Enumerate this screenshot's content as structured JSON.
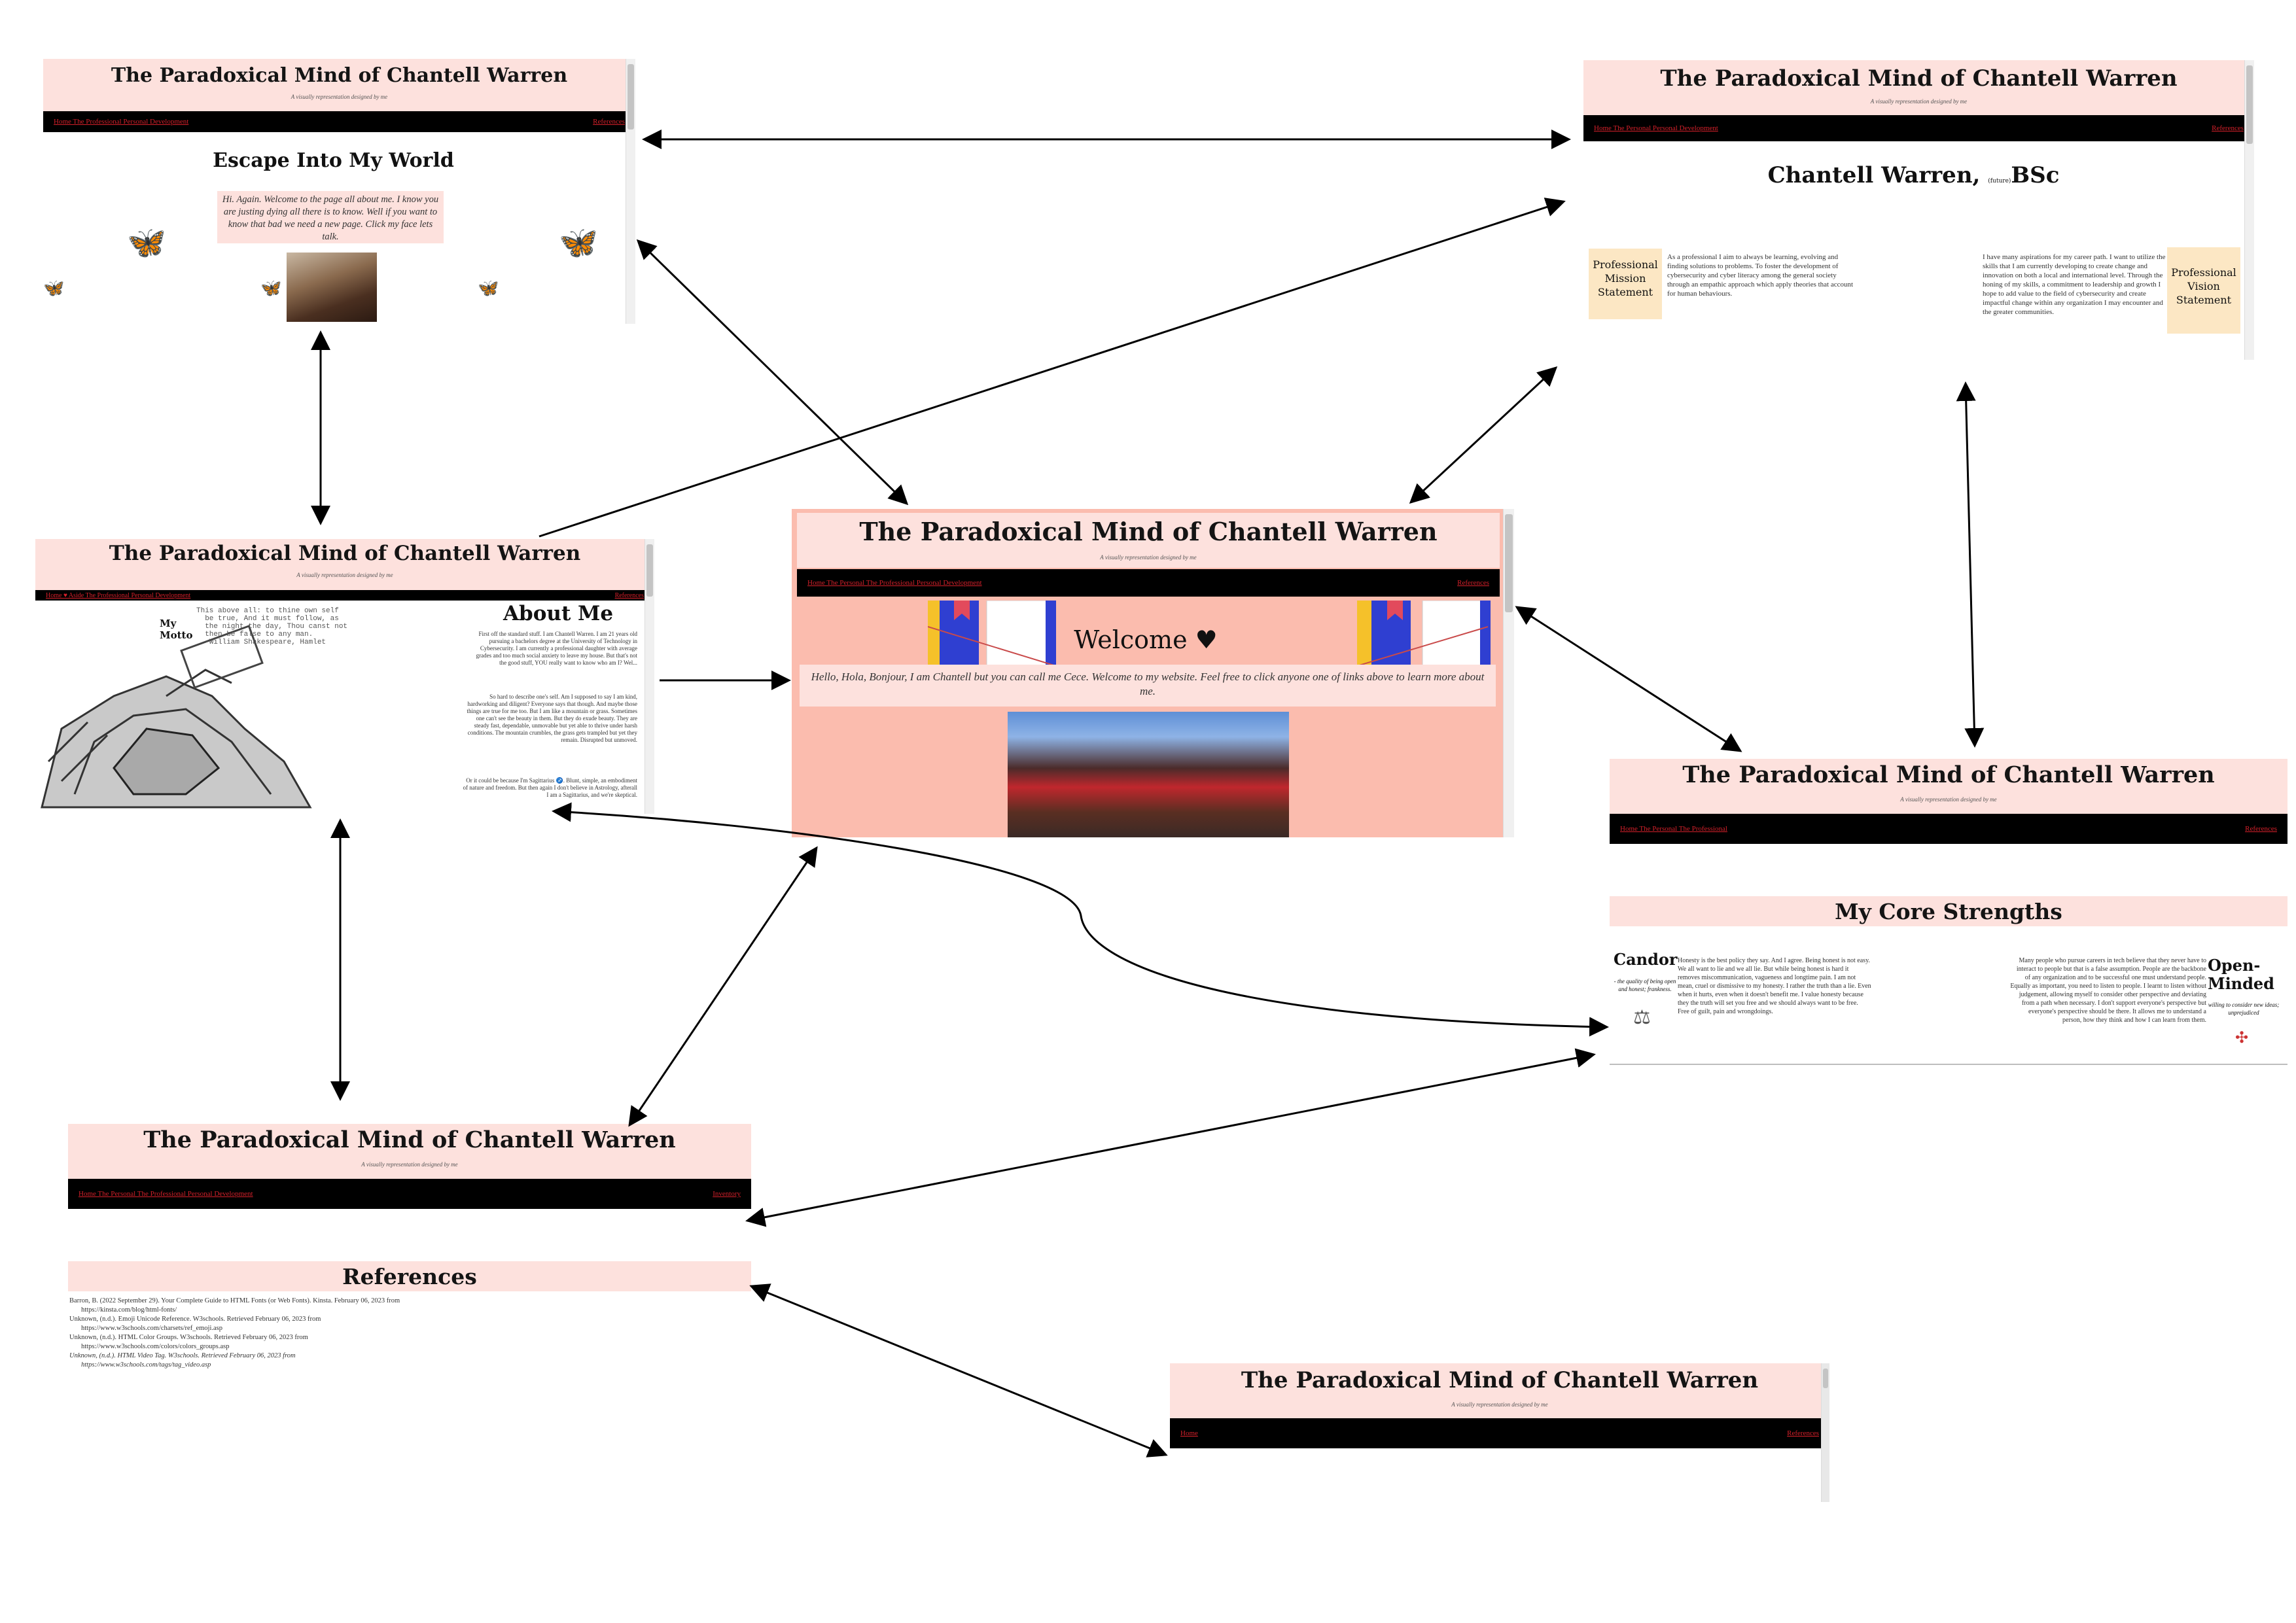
{
  "site": {
    "title": "The Paradoxical Mind of Chantell Warren",
    "subtitle": "A visually representation designed by me"
  },
  "pages": {
    "personal": {
      "nav_left": "Home The Professional Personal Development",
      "nav_right": "References",
      "heading": "Escape Into My World",
      "intro": "Hi. Again. Welcome to the page all about me. I know you are justing dying all there is to know. Well if you want to know that bad we need a new page. Click my face lets talk."
    },
    "professional": {
      "nav_left": "Home The Personal Personal Development",
      "nav_right": "References",
      "heading_name": "Chantell Warren,",
      "heading_small": "(future)",
      "heading_degree": "BSc",
      "mission_label": "Professional Mission Statement",
      "mission_text": "As a professional I aim to always be learning, evolving and finding solutions to problems. To foster the development of cybersecurity and cyber literacy among the general society through an empathic approach which apply theories that account for human behaviours.",
      "vision_label": "Professional Vision Statement",
      "vision_text": "I have many aspirations for my career path. I want to utilize the skills that I am currently developing to create change and innovation on both a local and international level. Through the honing of my skills, a commitment to leadership and growth I hope to add value to the field of cybersecurity and create impactful change within any organization I may encounter and the greater communities."
    },
    "about": {
      "nav_left": "Home ♥ Aside The Professional Personal Development",
      "nav_right": "References",
      "motto_label": "My Motto",
      "motto_text": "This above all: to thine own self\n  be true, And it must follow, as\n  the night the day, Thou canst not\n  then be false to any man.\n  -William Shakespeare, Hamlet",
      "heading": "About Me",
      "para1": "First off the standard stuff. I am Chantell Warren. I am 21 years old pursuing a bachelors degree at the University of Technology in Cybersecurity. I am currently a professional daughter with average grades and too much social anxiety to leave my house. But that's not the good stuff, YOU really want to know who am I? Wel...",
      "para2": "So hard to describe one's self. Am I supposed to say I am kind, hardworking and diligent? Everyone says that though. And maybe those things are true for me too. But I am like a mountain or grass. Sometimes one can't see the beauty in them. But they do exude beauty. They are steady fast, dependable, unmovable but yet able to thrive under harsh conditions. The mountain crumbles, the grass gets trampled but yet they remain. Disrupted but unmoved.",
      "para3": "Or it could be because I'm Sagittarius ♐. Blunt, simple, an embodiment of nature and freedom. But then again I don't believe in Astrology, afterall I am a Sagittarius, and we're skeptical."
    },
    "home": {
      "nav_left": "Home The Personal The Professional Personal Development",
      "nav_right": "References",
      "welcome": "Welcome ♥",
      "greeting": "Hello, Hola, Bonjour, I am Chantell but you can call me Cece. Welcome to my website. Feel free to click anyone one of links above to learn more about me."
    },
    "strengths": {
      "nav_left": "Home The Personal The Professional",
      "nav_right": "References",
      "heading": "My Core Strengths",
      "candor_title": "Candor",
      "candor_def": "- the quality of being open and honest; frankness.",
      "candor_text": "Honesty is the best policy they say. And I agree. Being honest is not easy. We all want to lie and we all lie. But while being honest is hard it removes miscommunication, vagueness and longtime pain. I am not mean, cruel or dismissive to my honesty. I rather the truth than a lie. Even when it hurts, even when it doesn't benefit me. I value honesty because they the truth will set you free and we should always want to be free. Free of guilt, pain and wrongdoings.",
      "open_title": "Open-Minded",
      "open_def": "willing to consider new ideas; unprejudiced",
      "open_text": "Many people who pursue careers in tech believe that they never have to interact to people but that is a false assumption. People are the backbone of any organization and to be successful one must understand people. Equally as important, you need to listen to people. I learnt to listen without judgement, allowing myself to consider other perspective and deviating from a path when necessary. I don't support everyone's perspective but everyone's perspective should be there. It allows me to understand a person, how they think and how I can learn from them."
    },
    "development": {
      "nav_left": "Home The Personal The Professional Personal Development",
      "nav_right": "Inventory"
    },
    "references": {
      "heading": "References",
      "items": [
        "Barron, B. (2022 September 29). Your Complete Guide to HTML Fonts (or Web Fonts). Kinsta. February 06, 2023 from",
        "    https://kinsta.com/blog/html-fonts/",
        "Unknown, (n.d.). Emoji Unicode Reference. W3schools. Retrieved February 06, 2023 from",
        "    https://www.w3schools.com/charsets/ref_emoji.asp",
        "Unknown, (n.d.). HTML Color Groups. W3schools. Retrieved February 06, 2023 from",
        "    https://www.w3schools.com/colors/colors_groups.asp",
        "Unknown, (n.d.). HTML Video Tag. W3schools. Retrieved February 06, 2023 from",
        "    https://www.w3schools.com/tags/tag_video.asp"
      ]
    },
    "bottom": {
      "nav_left": "Home",
      "nav_right": "References"
    }
  },
  "colors": {
    "header_pink": "#fde1dd",
    "nav_black": "#000000",
    "link_red": "#d4202a",
    "home_bg": "#fbbcae",
    "statement_box": "#fce7c4",
    "butterfly": "#d1208c"
  }
}
